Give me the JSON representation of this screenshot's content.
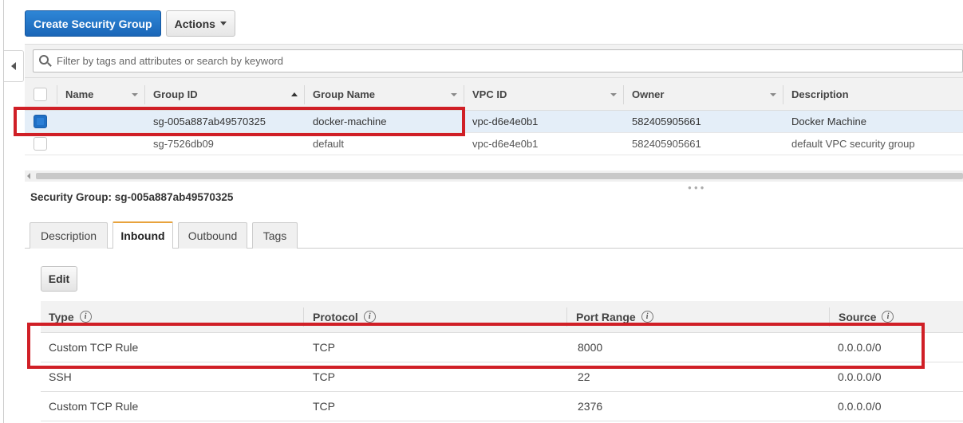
{
  "toolbar": {
    "create_label": "Create Security Group",
    "actions_label": "Actions"
  },
  "filter": {
    "placeholder": "Filter by tags and attributes or search by keyword"
  },
  "table": {
    "columns": [
      "Name",
      "Group ID",
      "Group Name",
      "VPC ID",
      "Owner",
      "Description"
    ],
    "rows": [
      {
        "selected": true,
        "name": "",
        "group_id": "sg-005a887ab49570325",
        "group_name": "docker-machine",
        "vpc_id": "vpc-d6e4e0b1",
        "owner": "582405905661",
        "description": "Docker Machine"
      },
      {
        "selected": false,
        "name": "",
        "group_id": "sg-7526db09",
        "group_name": "default",
        "vpc_id": "vpc-d6e4e0b1",
        "owner": "582405905661",
        "description": "default VPC security group"
      }
    ]
  },
  "detail": {
    "title": "Security Group: sg-005a887ab49570325",
    "tabs": [
      "Description",
      "Inbound",
      "Outbound",
      "Tags"
    ],
    "active_tab": "Inbound",
    "edit_label": "Edit",
    "rules": {
      "columns": [
        "Type",
        "Protocol",
        "Port Range",
        "Source"
      ],
      "rows": [
        {
          "type": "Custom TCP Rule",
          "protocol": "TCP",
          "port_range": "8000",
          "source": "0.0.0.0/0"
        },
        {
          "type": "SSH",
          "protocol": "TCP",
          "port_range": "22",
          "source": "0.0.0.0/0"
        },
        {
          "type": "Custom TCP Rule",
          "protocol": "TCP",
          "port_range": "2376",
          "source": "0.0.0.0/0"
        }
      ]
    }
  },
  "colors": {
    "primary_button": "#1a66b8",
    "selected_row": "#e4eef8",
    "active_tab_accent": "#e8a33d",
    "highlight_annotation": "#d01f26"
  },
  "icons": {
    "search": "search-icon",
    "collapse": "collapse-arrow-icon",
    "info": "info-icon",
    "dropdown": "chevron-down-icon"
  }
}
